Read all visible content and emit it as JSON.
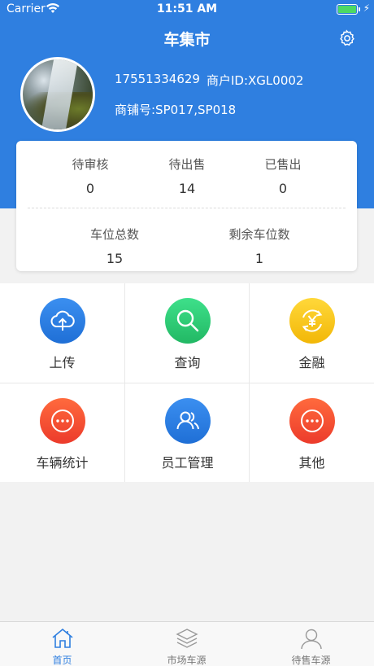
{
  "status_bar": {
    "carrier": "Carrier",
    "time": "11:51 AM"
  },
  "header": {
    "title": "车集市"
  },
  "profile": {
    "phone": "17551334629",
    "merchant_id": "商户ID:XGL0002",
    "shop_no": "商铺号:SP017,SP018"
  },
  "stats": {
    "pending_review": {
      "label": "待审核",
      "value": "0"
    },
    "for_sale": {
      "label": "待出售",
      "value": "14"
    },
    "sold": {
      "label": "已售出",
      "value": "0"
    },
    "total_spaces": {
      "label": "车位总数",
      "value": "15"
    },
    "remaining_spaces": {
      "label": "剩余车位数",
      "value": "1"
    }
  },
  "menu": {
    "upload": "上传",
    "query": "查询",
    "finance": "金融",
    "vehicle_stats": "车辆统计",
    "staff_management": "员工管理",
    "other": "其他"
  },
  "tabbar": {
    "home": "首页",
    "market": "市场车源",
    "for_sale": "待售车源"
  },
  "colors": {
    "header_blue": "#2f7fe0",
    "upload_blue": "#2f7fe0",
    "query_green": "#2ecc71",
    "finance_yellow": "#f5c518",
    "stats_red": "#f0533a",
    "staff_blue": "#2f7fe0",
    "other_red": "#f0533a"
  }
}
